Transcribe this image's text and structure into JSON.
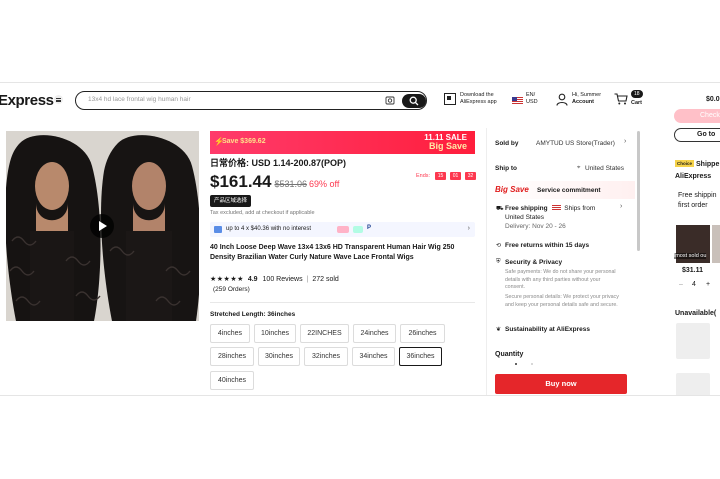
{
  "header": {
    "logo": "Express",
    "search_placeholder": "13x4 hd lace frontal wig human hair",
    "app_line1": "Download the",
    "app_line2": "AliExpress app",
    "lang_line1": "EN/",
    "lang_line2": "USD",
    "user_line1": "Hi, Summer",
    "user_line2": "Account",
    "cart_count": "18",
    "cart_label": "Cart"
  },
  "banner": {
    "save": "Save $369.62",
    "sale_line1": "11.11 SALE",
    "sale_line2": "Big Save"
  },
  "product": {
    "cn_price": "日常价格: USD 1.14-200.87(POP)",
    "price": "$161.44",
    "old_price": "$531.06",
    "discount": "69% off",
    "ends_label": "Ends:",
    "timer": [
      "15",
      "01",
      "32"
    ],
    "cn_badge": "产品区域选择",
    "tax_note": "Tax excluded, add at checkout if applicable",
    "installments": "up to 4 x $40.36 with no interest",
    "paypal": "P",
    "title": "40 Inch Loose Deep Wave 13x4 13x6 HD Transparent Human Hair Wig 250 Density Brazilian Water Curly Nature Wave Lace Frontal Wigs",
    "stars": "★★★★★",
    "rating": "4.9",
    "reviews": "100 Reviews",
    "sold": "272 sold",
    "orders": "(259 Orders)",
    "length_label": "Stretched Length: 36inches",
    "length_options": [
      "4inches",
      "10inches",
      "22INCHES",
      "24inches",
      "26inches",
      "28inches",
      "30inches",
      "32inches",
      "34inches",
      "36inches",
      "40inches"
    ],
    "selected_length": "36inches"
  },
  "side": {
    "sold_by_label": "Sold by",
    "sold_by_value": "AMYTUD US Store(Trader)",
    "ship_to_label": "Ship to",
    "ship_to_value": "United States",
    "big_save": "Big Save",
    "service_commitment": "Service commitment",
    "free_shipping": "Free shipping",
    "ships_from": "Ships from",
    "ships_from_country": "United States",
    "delivery": "Delivery: Nov 20 - 26",
    "free_returns": "Free returns within 15 days",
    "security": "Security & Privacy",
    "safe_payments": "Safe payments: We do not share your personal details with any third parties without your consent.",
    "secure_personal": "Secure personal details: We protect your privacy and keep your personal details safe and secure.",
    "sustainability": "Sustainability at AliExpress",
    "quantity_label": "Quantity",
    "buy_now": "Buy now"
  },
  "far_right": {
    "price": "$0.0",
    "checkout": "Check",
    "go_to": "Go to",
    "choice": "Choice",
    "shipped": "Shippe",
    "aliexpress": "AliExpress",
    "free_shipping": "Free shippin",
    "first_order": "first order",
    "almost_sold": "lmost sold ou",
    "item_price": "$31.11",
    "item_qty": "4",
    "unavailable": "Unavailable("
  }
}
